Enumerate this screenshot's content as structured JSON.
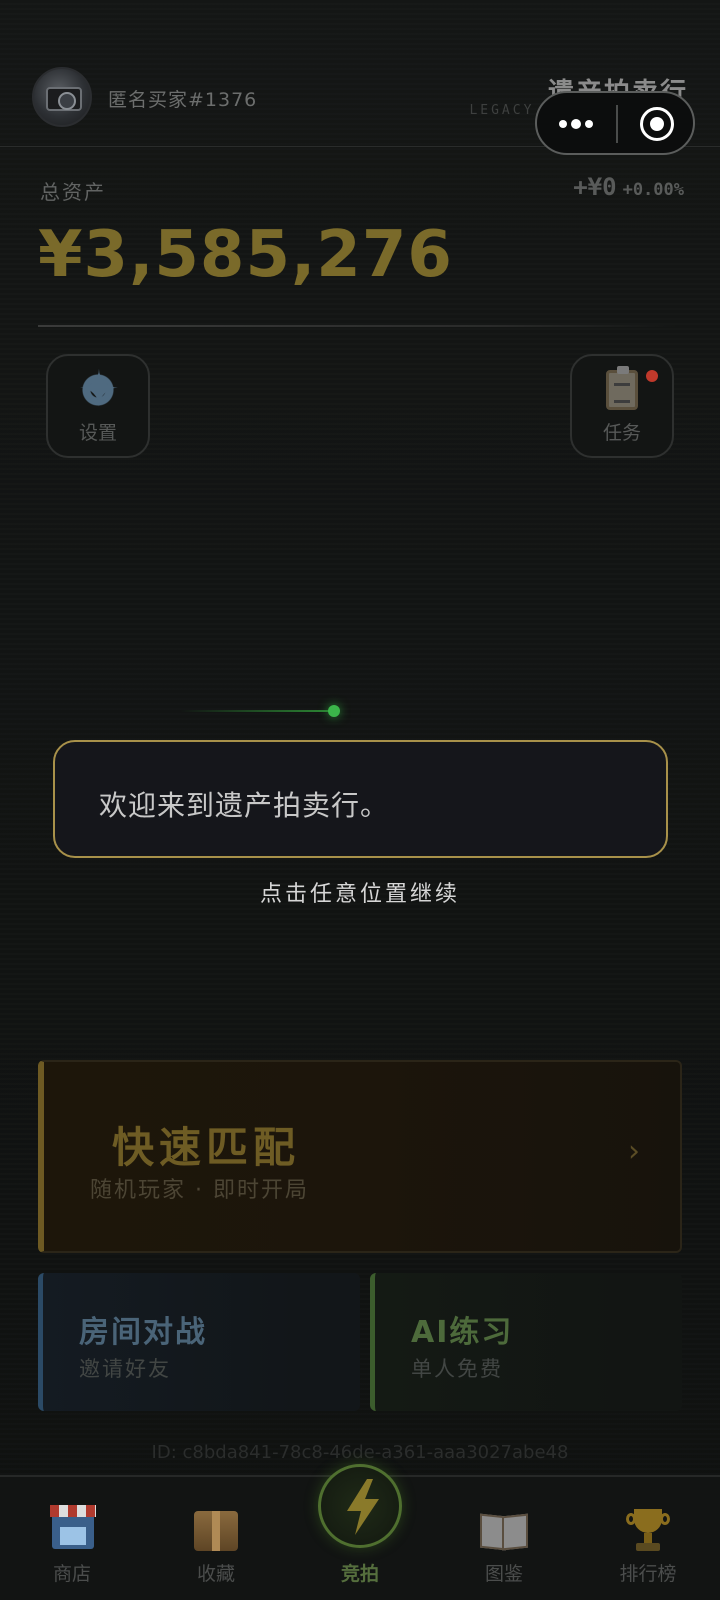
{
  "header": {
    "username": "匿名买家#1376",
    "brand_title": "遗产拍卖行",
    "brand_subtitle": "LEGACY AUCTION HOUSE"
  },
  "capsule": {
    "more_icon": "more-dots-icon",
    "close_icon": "target-icon"
  },
  "assets": {
    "label": "总资产",
    "total": "¥3,585,276",
    "change_amount": "+¥0",
    "change_percent": "+0.00%"
  },
  "buttons": {
    "settings_label": "设置",
    "tasks_label": "任务",
    "settings_icon": "gear-icon",
    "tasks_icon": "clipboard-icon"
  },
  "dialog": {
    "text": "欢迎来到遗产拍卖行。",
    "continue_hint": "点击任意位置继续"
  },
  "quick_match": {
    "title": "快速匹配",
    "subtitle": "随机玩家 · 即时开局",
    "arrow": "›"
  },
  "room_battle": {
    "title": "房间对战",
    "subtitle": "邀请好友"
  },
  "ai_practice": {
    "title": "AI练习",
    "subtitle": "单人免费"
  },
  "session_id": "ID: c8bda841-78c8-46de-a361-aaa3027abe48",
  "tabbar": {
    "shop": "商店",
    "collection": "收藏",
    "bid": "竞拍",
    "catalog": "图鉴",
    "leaderboard": "排行榜"
  },
  "colors": {
    "gold": "#7a6a2a",
    "dialog_border": "#a8914a",
    "active_green": "#556e3d",
    "notification_red": "#c0392b"
  }
}
